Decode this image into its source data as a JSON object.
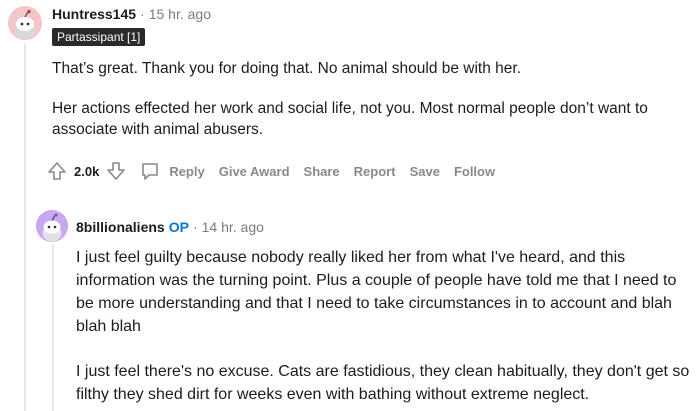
{
  "comments": [
    {
      "author": "Huntress145",
      "separator": "·",
      "time": "15 hr. ago",
      "flair": "Partassipant [1]",
      "paragraphs": [
        "That’s great. Thank you for doing that. No animal should be with her.",
        "Her actions effected her work and social life, not you. Most normal people don’t want to associate with animal abusers."
      ],
      "actions": {
        "vote_count": "2.0k",
        "reply": "Reply",
        "give_award": "Give Award",
        "share": "Share",
        "report": "Report",
        "save": "Save",
        "follow": "Follow"
      },
      "avatar_color": "#f3c6c8"
    },
    {
      "author": "8billionaliens",
      "op_badge": "OP",
      "separator": "·",
      "time": "14 hr. ago",
      "paragraphs": [
        "I just feel guilty because nobody really liked her from what I've heard, and this information was the turning point. Plus a couple of people have told me that I need to be more understanding and that I need to take circumstances in to account and blah blah blah",
        "I just feel there's no excuse. Cats are fastidious, they clean habitually, they don't get so filthy they shed dirt for weeks even with bathing without extreme neglect."
      ],
      "avatar_color": "#c9a6f0"
    }
  ],
  "colors": {
    "op_blue": "#0079d3",
    "action_gray": "#878a8c",
    "meta_gray": "#7c7c7c"
  },
  "icons": [
    "snoo-avatar-icon",
    "upvote-arrow-icon",
    "downvote-arrow-icon",
    "comment-bubble-icon"
  ]
}
